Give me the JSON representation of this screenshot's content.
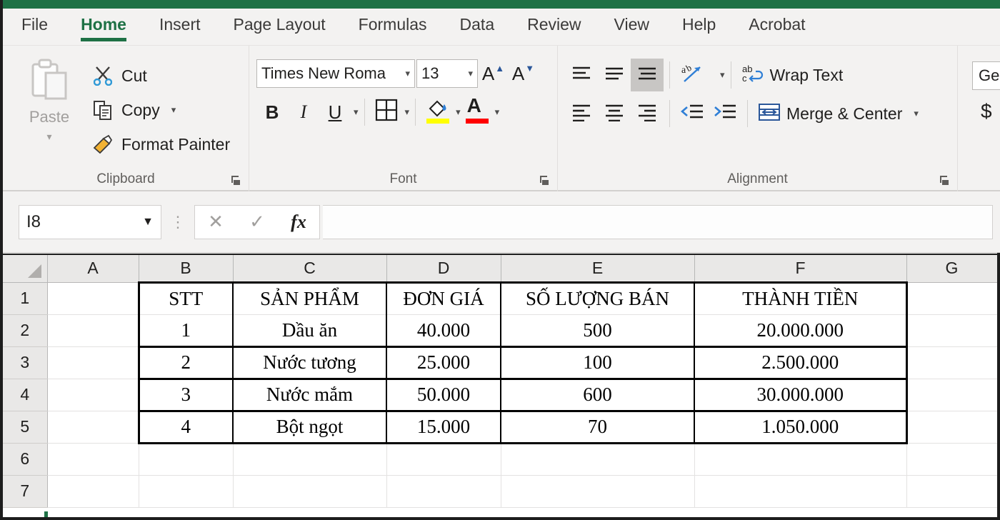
{
  "theme": {
    "accent_green": "#1e7145",
    "ribbon_bg": "#f3f2f1",
    "header_gray": "#e9e8e7",
    "highlight_yellow": "#ffff00",
    "font_color_red": "#ff0000"
  },
  "tabs": [
    {
      "label": "File",
      "active": false
    },
    {
      "label": "Home",
      "active": true
    },
    {
      "label": "Insert",
      "active": false
    },
    {
      "label": "Page Layout",
      "active": false
    },
    {
      "label": "Formulas",
      "active": false
    },
    {
      "label": "Data",
      "active": false
    },
    {
      "label": "Review",
      "active": false
    },
    {
      "label": "View",
      "active": false
    },
    {
      "label": "Help",
      "active": false
    },
    {
      "label": "Acrobat",
      "active": false
    }
  ],
  "ribbon": {
    "clipboard": {
      "group_label": "Clipboard",
      "paste_label": "Paste",
      "cut_label": "Cut",
      "copy_label": "Copy",
      "format_painter_label": "Format Painter"
    },
    "font": {
      "group_label": "Font",
      "font_name": "Times New Roma",
      "font_size": "13",
      "bold_label": "B",
      "italic_label": "I",
      "underline_label": "U",
      "grow_font_label": "A",
      "shrink_font_label": "A",
      "borders_name": "borders-icon",
      "fill_color_name": "fill-color-icon",
      "font_color_name": "font-color-icon"
    },
    "alignment": {
      "group_label": "Alignment",
      "wrap_text_label": "Wrap Text",
      "merge_center_label": "Merge & Center",
      "orientation_name": "orientation-icon",
      "top_align_name": "align-top-icon",
      "middle_align_name": "align-middle-icon",
      "bottom_align_name": "align-bottom-icon",
      "left_align_name": "align-left-icon",
      "center_align_name": "align-center-icon",
      "right_align_name": "align-right-icon",
      "decrease_indent_name": "decrease-indent-icon",
      "increase_indent_name": "increase-indent-icon"
    },
    "number": {
      "format_value": "Gen",
      "currency_label": "$"
    }
  },
  "formula_bar": {
    "name_box_value": "I8",
    "formula_value": "",
    "cancel_label": "✕",
    "enter_label": "✓",
    "insert_function_label": "fx"
  },
  "sheet": {
    "columns": [
      "A",
      "B",
      "C",
      "D",
      "E",
      "F",
      "G"
    ],
    "rows": [
      "1",
      "2",
      "3",
      "4",
      "5",
      "6",
      "7"
    ],
    "table": {
      "headers": [
        "STT",
        "SẢN PHẨM",
        "ĐƠN GIÁ",
        "SỐ LƯỢNG BÁN",
        "THÀNH TIỀN"
      ],
      "rows": [
        [
          "1",
          "Dầu ăn",
          "40.000",
          "500",
          "20.000.000"
        ],
        [
          "2",
          "Nước tương",
          "25.000",
          "100",
          "2.500.000"
        ],
        [
          "3",
          "Nước mắm",
          "50.000",
          "600",
          "30.000.000"
        ],
        [
          "4",
          "Bột ngọt",
          "15.000",
          "70",
          "1.050.000"
        ]
      ]
    }
  }
}
